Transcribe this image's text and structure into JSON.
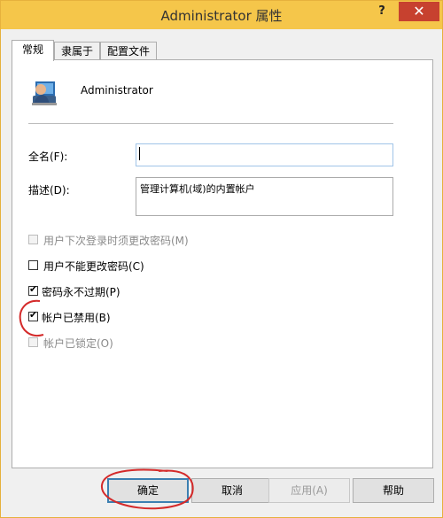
{
  "window": {
    "title": "Administrator 属性",
    "help_glyph": "?",
    "close_glyph": "✕"
  },
  "tabs": [
    {
      "label": "常规",
      "active": true
    },
    {
      "label": "隶属于",
      "active": false
    },
    {
      "label": "配置文件",
      "active": false
    }
  ],
  "user": {
    "name": "Administrator",
    "icon": "user-account-icon"
  },
  "fields": {
    "fullname": {
      "label": "全名(F):",
      "value": ""
    },
    "description": {
      "label": "描述(D):",
      "value": "管理计算机(域)的内置帐户"
    }
  },
  "checkboxes": [
    {
      "label": "用户下次登录时须更改密码(M)",
      "checked": false,
      "enabled": false
    },
    {
      "label": "用户不能更改密码(C)",
      "checked": false,
      "enabled": true
    },
    {
      "label": "密码永不过期(P)",
      "checked": true,
      "enabled": true
    },
    {
      "label": "帐户已禁用(B)",
      "checked": true,
      "enabled": true
    },
    {
      "label": "帐户已锁定(O)",
      "checked": false,
      "enabled": false
    }
  ],
  "buttons": {
    "ok": "确定",
    "cancel": "取消",
    "apply": "应用(A)",
    "help": "帮助"
  },
  "checkmark": "✔",
  "colors": {
    "titlebar": "#f5c64a",
    "close": "#c7412f",
    "annotation": "#d42a2a",
    "default_button_border": "#3c7fb1"
  }
}
